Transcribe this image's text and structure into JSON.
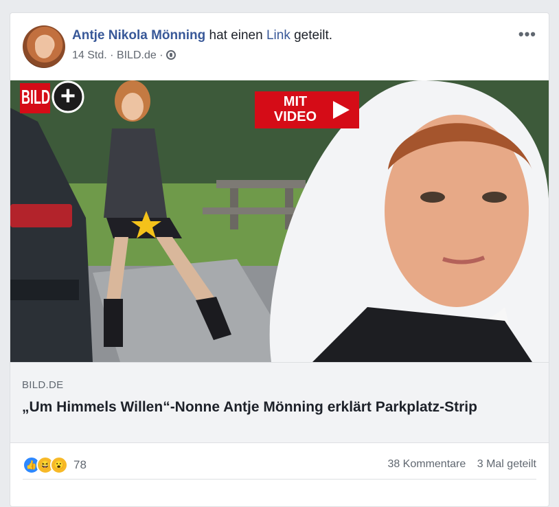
{
  "post": {
    "author": "Antje Nikola Mönning",
    "action_prefix": "hat einen",
    "action_link": "Link",
    "action_suffix": "geteilt.",
    "time": "14 Std.",
    "separator": "·",
    "source": "BILD.de",
    "more_icon": "more-icon"
  },
  "image": {
    "brand_logo": "BILD",
    "plus_symbol": "+",
    "video_badge_line1": "MIT",
    "video_badge_line2": "VIDEO"
  },
  "link_preview": {
    "domain": "BILD.DE",
    "headline": "„Um Himmels Willen“-Nonne Antje Mönning erklärt Parkplatz-Strip"
  },
  "footer": {
    "reaction_icons": [
      "like-icon",
      "haha-icon",
      "wow-icon"
    ],
    "reaction_count": "78",
    "comments": "38 Kommentare",
    "shares": "3 Mal geteilt"
  },
  "colors": {
    "link_blue": "#385898",
    "bild_red": "#d50c17",
    "like_blue": "#2d88ff"
  }
}
